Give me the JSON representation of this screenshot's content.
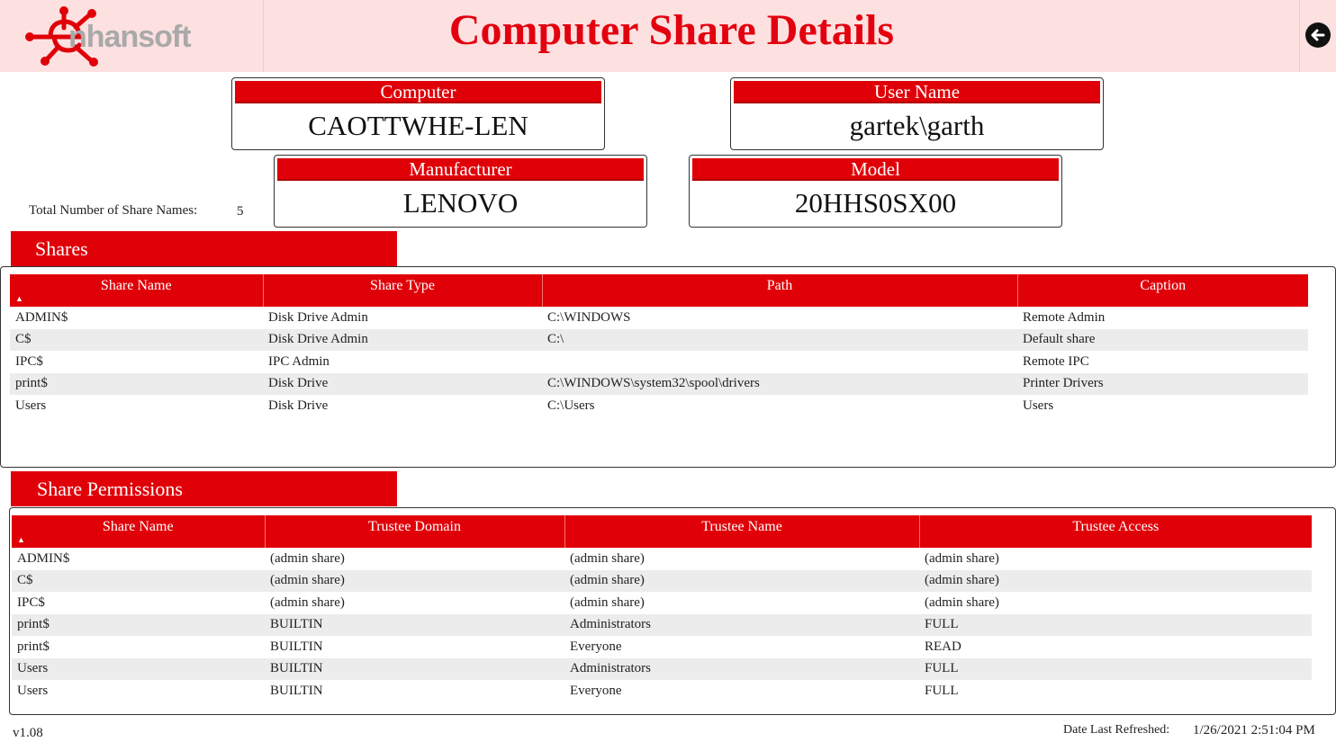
{
  "header": {
    "logo_text": "nhansoft",
    "title": "Computer Share Details"
  },
  "cards": {
    "computer": {
      "label": "Computer",
      "value": "CAOTTWHE-LEN"
    },
    "user_name": {
      "label": "User Name",
      "value": "gartek\\garth"
    },
    "manufacturer": {
      "label": "Manufacturer",
      "value": "LENOVO"
    },
    "model": {
      "label": "Model",
      "value": "20HHS0SX00"
    }
  },
  "summary": {
    "total_label": "Total Number of Share Names:",
    "total_value": "5"
  },
  "shares": {
    "section_title": "Shares",
    "columns": [
      "Share Name",
      "Share Type",
      "Path",
      "Caption"
    ],
    "rows": [
      [
        "ADMIN$",
        "Disk Drive Admin",
        "C:\\WINDOWS",
        "Remote Admin"
      ],
      [
        "C$",
        "Disk Drive Admin",
        "C:\\",
        "Default share"
      ],
      [
        "IPC$",
        "IPC Admin",
        "",
        "Remote IPC"
      ],
      [
        "print$",
        "Disk Drive",
        "C:\\WINDOWS\\system32\\spool\\drivers",
        "Printer Drivers"
      ],
      [
        "Users",
        "Disk Drive",
        "C:\\Users",
        "Users"
      ]
    ]
  },
  "permissions": {
    "section_title": "Share Permissions",
    "columns": [
      "Share Name",
      "Trustee Domain",
      "Trustee Name",
      "Trustee Access"
    ],
    "rows": [
      [
        "ADMIN$",
        "(admin share)",
        "(admin share)",
        "(admin share)"
      ],
      [
        "C$",
        "(admin share)",
        "(admin share)",
        "(admin share)"
      ],
      [
        "IPC$",
        "(admin share)",
        "(admin share)",
        "(admin share)"
      ],
      [
        "print$",
        "BUILTIN",
        "Administrators",
        "FULL"
      ],
      [
        "print$",
        "BUILTIN",
        "Everyone",
        "READ"
      ],
      [
        "Users",
        "BUILTIN",
        "Administrators",
        "FULL"
      ],
      [
        "Users",
        "BUILTIN",
        "Everyone",
        "FULL"
      ]
    ]
  },
  "footer": {
    "version": "v1.08",
    "refresh_label": "Date Last Refreshed:",
    "refresh_value": "1/26/2021 2:51:04 PM"
  },
  "icons": {
    "logo": "enhansoft-logo-icon",
    "back": "back-arrow-icon",
    "sort": "sort-ascending-icon"
  },
  "colors": {
    "accent": "#e00008",
    "header_bg": "#fde0e0",
    "title": "#e3000f",
    "row_alt": "#ececec"
  }
}
